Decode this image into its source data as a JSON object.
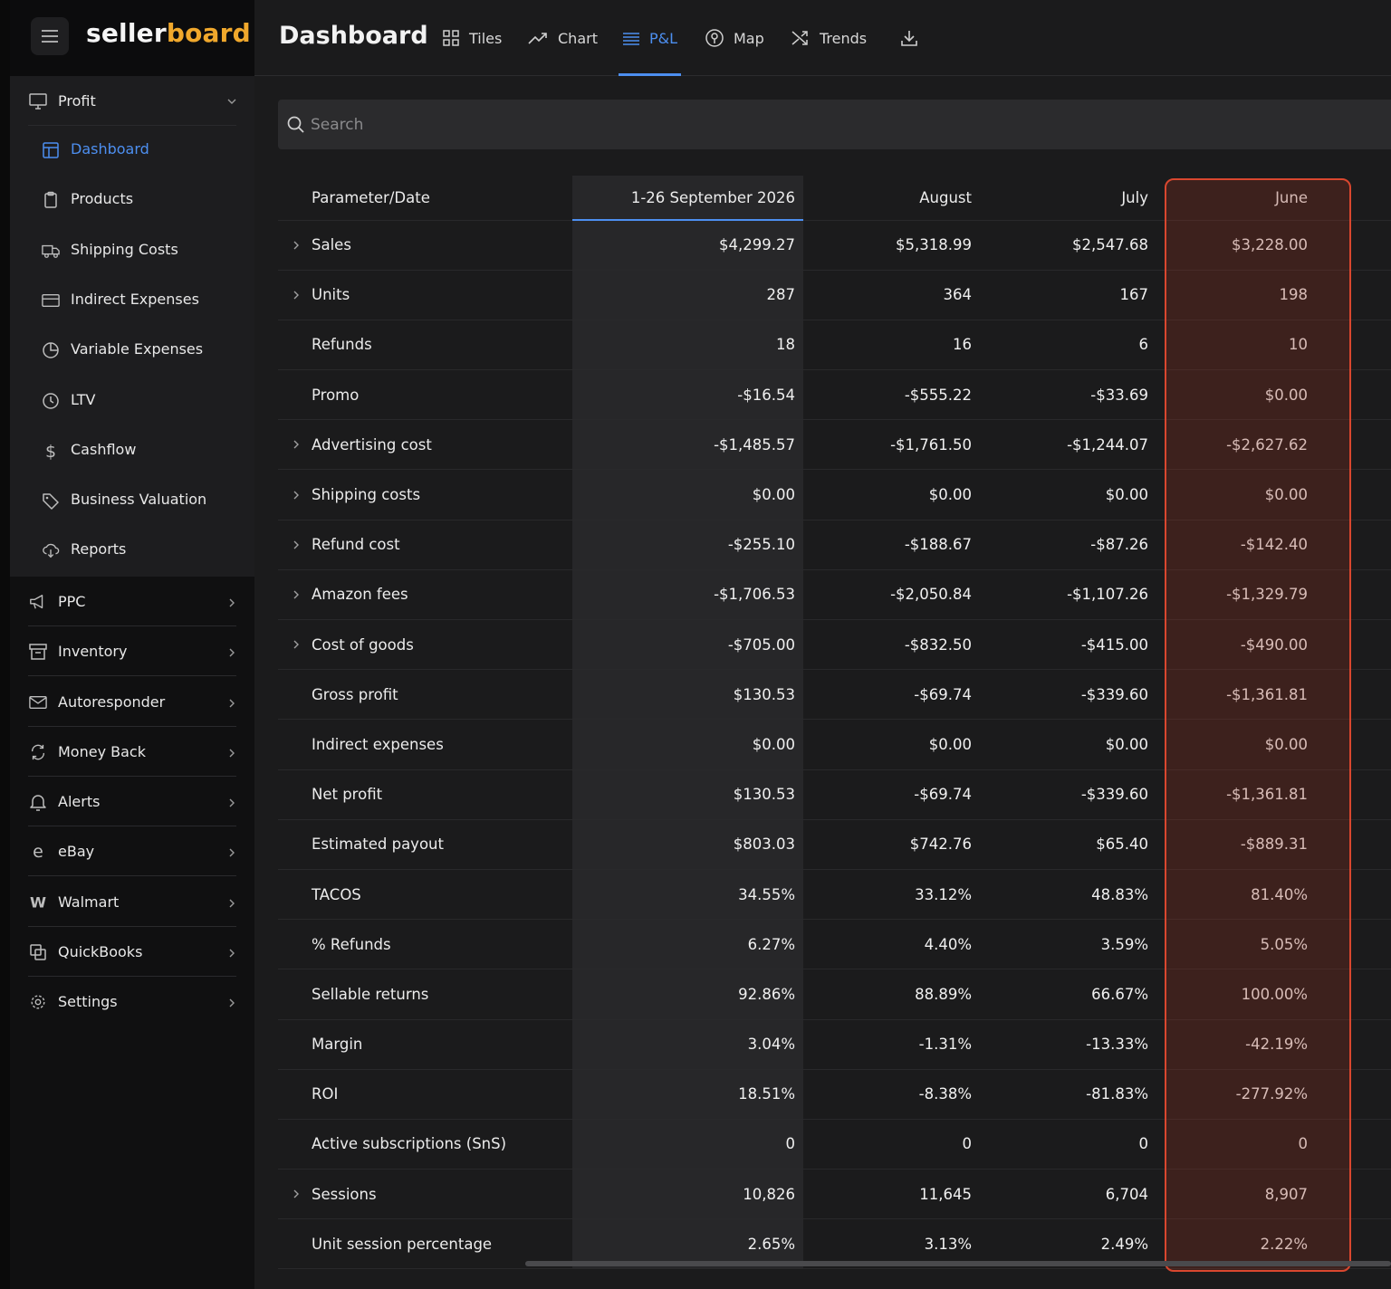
{
  "brand": {
    "part1": "seller",
    "part2": "board"
  },
  "sidebar": {
    "profit": {
      "label": "Profit",
      "children": [
        {
          "label": "Dashboard",
          "icon": "dashboard-icon",
          "active": true
        },
        {
          "label": "Products",
          "icon": "clipboard-icon"
        },
        {
          "label": "Shipping Costs",
          "icon": "truck-icon"
        },
        {
          "label": "Indirect Expenses",
          "icon": "card-icon"
        },
        {
          "label": "Variable Expenses",
          "icon": "pie-chart-icon"
        },
        {
          "label": "LTV",
          "icon": "clock-icon"
        },
        {
          "label": "Cashflow",
          "icon": "dollar-icon"
        },
        {
          "label": "Business Valuation",
          "icon": "tag-icon"
        },
        {
          "label": "Reports",
          "icon": "cloud-download-icon"
        }
      ]
    },
    "groups": [
      {
        "label": "PPC",
        "icon": "megaphone-icon"
      },
      {
        "label": "Inventory",
        "icon": "archive-box-icon"
      },
      {
        "label": "Autoresponder",
        "icon": "envelope-icon"
      },
      {
        "label": "Money Back",
        "icon": "refresh-icon"
      },
      {
        "label": "Alerts",
        "icon": "bell-icon"
      },
      {
        "label": "eBay",
        "icon": "ebay-icon"
      },
      {
        "label": "Walmart",
        "icon": "walmart-icon"
      },
      {
        "label": "QuickBooks",
        "icon": "copy-icon"
      },
      {
        "label": "Settings",
        "icon": "gear-icon"
      }
    ]
  },
  "header": {
    "title": "Dashboard",
    "tabs": [
      {
        "label": "Tiles",
        "icon": "grid-icon"
      },
      {
        "label": "Chart",
        "icon": "trend-line-icon"
      },
      {
        "label": "P&L",
        "icon": "list-icon",
        "active": true
      },
      {
        "label": "Map",
        "icon": "map-pin-icon"
      },
      {
        "label": "Trends",
        "icon": "shuffle-icon"
      }
    ],
    "download_icon": "download-icon"
  },
  "search": {
    "placeholder": "Search",
    "value": ""
  },
  "colors": {
    "accent": "#4d8ff0",
    "brand": "#f0a82c",
    "highlight": "#d9472f"
  },
  "table": {
    "columns": [
      "Parameter/Date",
      "1-26 September 2026",
      "August",
      "July",
      "June"
    ],
    "rows": [
      {
        "label": "Sales",
        "expandable": true,
        "values": [
          "$4,299.27",
          "$5,318.99",
          "$2,547.68",
          "$3,228.00"
        ]
      },
      {
        "label": "Units",
        "expandable": true,
        "values": [
          "287",
          "364",
          "167",
          "198"
        ]
      },
      {
        "label": "Refunds",
        "expandable": false,
        "values": [
          "18",
          "16",
          "6",
          "10"
        ]
      },
      {
        "label": "Promo",
        "expandable": false,
        "values": [
          "-$16.54",
          "-$555.22",
          "-$33.69",
          "$0.00"
        ]
      },
      {
        "label": "Advertising cost",
        "expandable": true,
        "values": [
          "-$1,485.57",
          "-$1,761.50",
          "-$1,244.07",
          "-$2,627.62"
        ]
      },
      {
        "label": "Shipping costs",
        "expandable": true,
        "values": [
          "$0.00",
          "$0.00",
          "$0.00",
          "$0.00"
        ]
      },
      {
        "label": "Refund cost",
        "expandable": true,
        "values": [
          "-$255.10",
          "-$188.67",
          "-$87.26",
          "-$142.40"
        ]
      },
      {
        "label": "Amazon fees",
        "expandable": true,
        "values": [
          "-$1,706.53",
          "-$2,050.84",
          "-$1,107.26",
          "-$1,329.79"
        ]
      },
      {
        "label": "Cost of goods",
        "expandable": true,
        "values": [
          "-$705.00",
          "-$832.50",
          "-$415.00",
          "-$490.00"
        ]
      },
      {
        "label": "Gross profit",
        "expandable": false,
        "values": [
          "$130.53",
          "-$69.74",
          "-$339.60",
          "-$1,361.81"
        ]
      },
      {
        "label": "Indirect expenses",
        "expandable": false,
        "values": [
          "$0.00",
          "$0.00",
          "$0.00",
          "$0.00"
        ]
      },
      {
        "label": "Net profit",
        "expandable": false,
        "values": [
          "$130.53",
          "-$69.74",
          "-$339.60",
          "-$1,361.81"
        ]
      },
      {
        "label": "Estimated payout",
        "expandable": false,
        "values": [
          "$803.03",
          "$742.76",
          "$65.40",
          "-$889.31"
        ]
      },
      {
        "label": "TACOS",
        "expandable": false,
        "values": [
          "34.55%",
          "33.12%",
          "48.83%",
          "81.40%"
        ]
      },
      {
        "label": "% Refunds",
        "expandable": false,
        "values": [
          "6.27%",
          "4.40%",
          "3.59%",
          "5.05%"
        ]
      },
      {
        "label": "Sellable returns",
        "expandable": false,
        "values": [
          "92.86%",
          "88.89%",
          "66.67%",
          "100.00%"
        ]
      },
      {
        "label": "Margin",
        "expandable": false,
        "values": [
          "3.04%",
          "-1.31%",
          "-13.33%",
          "-42.19%"
        ]
      },
      {
        "label": "ROI",
        "expandable": false,
        "values": [
          "18.51%",
          "-8.38%",
          "-81.83%",
          "-277.92%"
        ]
      },
      {
        "label": "Active subscriptions (SnS)",
        "expandable": false,
        "values": [
          "0",
          "0",
          "0",
          "0"
        ]
      },
      {
        "label": "Sessions",
        "expandable": true,
        "values": [
          "10,826",
          "11,645",
          "6,704",
          "8,907"
        ]
      },
      {
        "label": "Unit session percentage",
        "expandable": false,
        "values": [
          "2.65%",
          "3.13%",
          "2.49%",
          "2.22%"
        ]
      }
    ]
  }
}
